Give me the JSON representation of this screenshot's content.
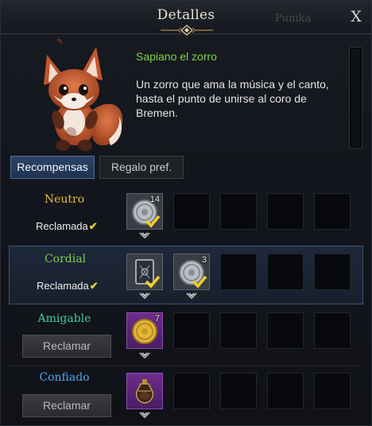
{
  "header": {
    "title": "Detalles",
    "ghost_name": "Punika",
    "close_label": "X"
  },
  "pet": {
    "name": "Sapiano el zorro",
    "description": "Un zorro que ama la música y el canto, hasta el punto de unirse al coro de Bremen."
  },
  "tabs": [
    {
      "label": "Recompensas",
      "active": true
    },
    {
      "label": "Regalo pref.",
      "active": false
    }
  ],
  "tiers": [
    {
      "name": "Neutro",
      "color": "#e8b93a",
      "status": "Reclamada",
      "claimed": true,
      "rewards": [
        {
          "icon": "silver-coin-icon",
          "qty": "14",
          "claimed": true
        }
      ]
    },
    {
      "name": "Cordial",
      "color": "#7ed04a",
      "status": "Reclamada",
      "claimed": true,
      "rewards": [
        {
          "icon": "card-pack-icon",
          "qty": "",
          "claimed": true
        },
        {
          "icon": "silver-coin-icon",
          "qty": "3",
          "claimed": true
        }
      ]
    },
    {
      "name": "Amigable",
      "color": "#3fcf9a",
      "status": "Reclamar",
      "claimed": false,
      "rewards": [
        {
          "icon": "gold-coin-icon",
          "qty": "7",
          "claimed": false
        }
      ]
    },
    {
      "name": "Confiado",
      "color": "#4aa8e8",
      "status": "Reclamar",
      "claimed": false,
      "rewards": [
        {
          "icon": "potion-flask-icon",
          "qty": "",
          "claimed": false
        }
      ]
    }
  ]
}
